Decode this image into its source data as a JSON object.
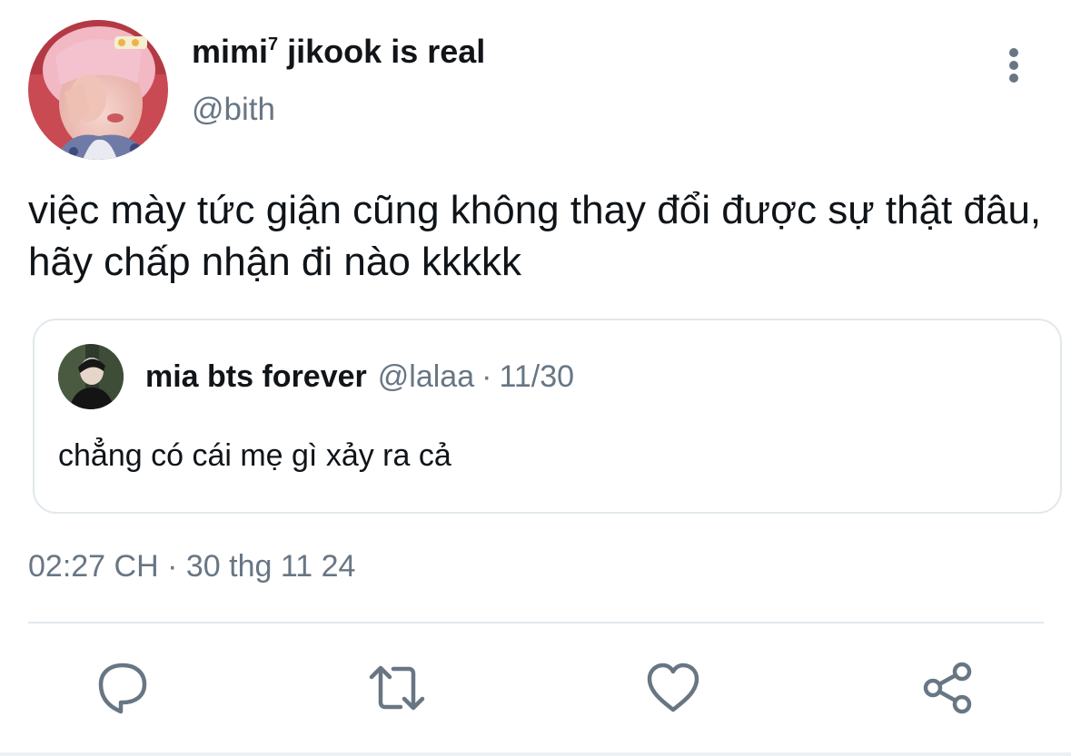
{
  "tweet": {
    "author": {
      "display_name": "mimi",
      "display_name_superscript": "7",
      "display_name_suffix": " jikook is real",
      "handle": "@bith"
    },
    "text": "việc mày tức giận cũng không thay đổi được sự thật đâu, hãy chấp nhận đi nào kkkkk",
    "quoted_tweet": {
      "display_name": "mia bts forever",
      "handle": "@lalaa",
      "date": "11/30",
      "separator": "·",
      "text": "chẳng có cái mẹ gì xảy ra cả"
    },
    "timestamp": "02:27 CH · 30 thg 11 24"
  },
  "icons": {
    "more": "more-vertical-icon",
    "reply": "reply-icon",
    "retweet": "retweet-icon",
    "like": "heart-icon",
    "share": "share-icon"
  },
  "colors": {
    "text_primary": "#0f1419",
    "text_secondary": "#687684",
    "border": "#e1e8ed",
    "background": "#ffffff"
  }
}
